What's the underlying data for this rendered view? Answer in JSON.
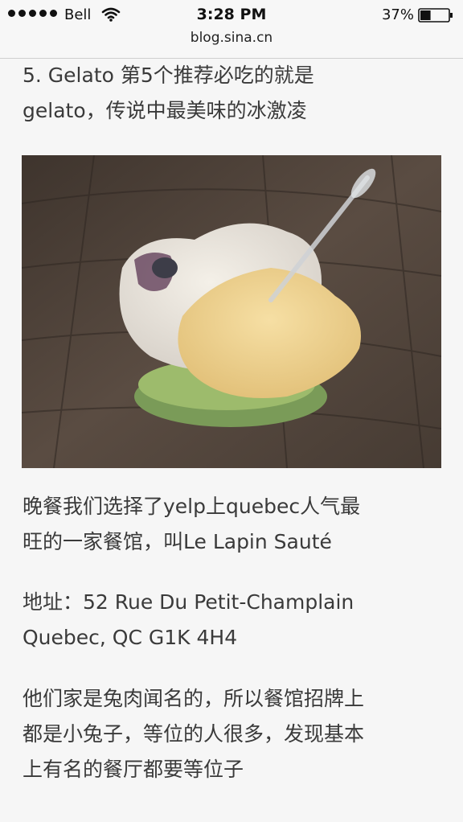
{
  "status_bar": {
    "carrier": "Bell",
    "time": "3:28 PM",
    "battery_percent": "37%",
    "battery_level": 0.37
  },
  "browser": {
    "url": "blog.sina.cn"
  },
  "article": {
    "paragraph_1": "5. Gelato 第5个推荐必吃的就是\ngelato，传说中最美味的冰激凌",
    "paragraph_2": "晚餐我们选择了yelp上quebec人气最\n旺的一家餐馆，叫Le Lapin Sauté",
    "paragraph_3": "地址：52 Rue Du Petit-Champlain\nQuebec, QC G1K 4H4",
    "paragraph_4": "他们家是兔肉闻名的，所以餐馆招牌上\n都是小兔子，等位的人很多，发现基本\n上有名的餐厅都要等位子"
  },
  "icons": {
    "signal": "signal-dots-icon",
    "wifi": "wifi-icon",
    "battery": "battery-icon"
  }
}
